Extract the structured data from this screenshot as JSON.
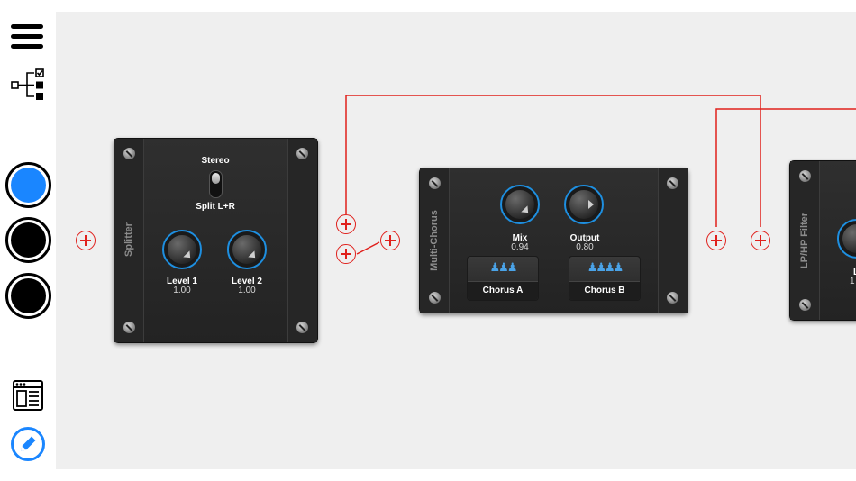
{
  "colors": {
    "accent_blue": "#1a86ff",
    "wire_red": "#e0201c",
    "canvas_bg": "#efefef",
    "module_bg": "#2a2a2a",
    "knob_ring": "#1e8fe0"
  },
  "sidebar": {
    "menu_icon": "hamburger-menu-icon",
    "routing_icon": "signal-tree-icon",
    "color_buttons": [
      {
        "name": "blue",
        "color": "#1a86ff",
        "selected": true
      },
      {
        "name": "black-1",
        "color": "#000000",
        "selected": false
      },
      {
        "name": "black-2",
        "color": "#000000",
        "selected": false
      }
    ],
    "presets_icon": "browser-window-icon",
    "edit_icon": "pencil-icon"
  },
  "modules": {
    "splitter": {
      "title": "Splitter",
      "switch_top_label": "Stereo",
      "switch_bottom_label": "Split L+R",
      "knobs": [
        {
          "label": "Level 1",
          "value": "1.00"
        },
        {
          "label": "Level 2",
          "value": "1.00"
        }
      ]
    },
    "multi_chorus": {
      "title": "Multi-Chorus",
      "knobs": [
        {
          "label": "Mix",
          "value": "0.94"
        },
        {
          "label": "Output",
          "value": "0.80"
        }
      ],
      "presets": [
        {
          "label": "Chorus A",
          "icon": "small-group-icon"
        },
        {
          "label": "Chorus B",
          "icon": "large-group-icon"
        }
      ]
    },
    "lp_hp_filter": {
      "title": "LP/HP Filter",
      "knob_label_partial": "L",
      "knob_value_partial": "1"
    }
  },
  "add_buttons_icon": "add-node-icon"
}
